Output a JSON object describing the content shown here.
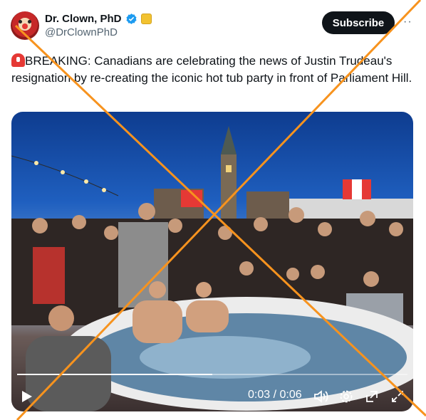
{
  "author": {
    "name": "Dr. Clown, PhD",
    "handle": "@DrClownPhD"
  },
  "subscribe_label": "Subscribe",
  "more_label": "··",
  "tweet": {
    "text": "BREAKING: Canadians are celebrating the news of Justin Trudeau's resignation by re-creating the iconic hot tub party in front of Parliament Hill."
  },
  "video": {
    "time": "0:03 / 0:06",
    "progress": 0.5
  },
  "colors": {
    "verified": "#1d9bf0",
    "overlay_cross": "#f7931e",
    "subscribe_bg": "#0f1419"
  },
  "icons": [
    "siren-icon",
    "verified-icon",
    "play-icon",
    "volume-icon",
    "settings-icon",
    "popout-icon",
    "fullscreen-icon"
  ]
}
